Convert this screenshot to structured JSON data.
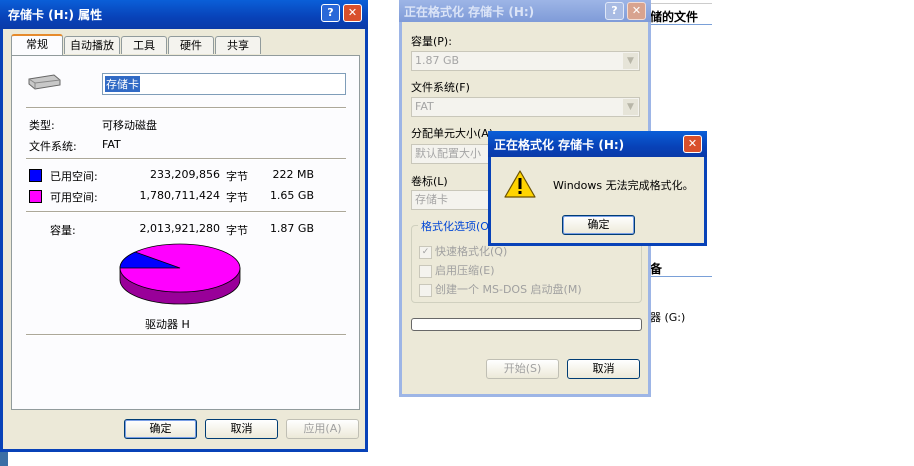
{
  "props": {
    "title": "存储卡 (H:) 属性",
    "tabs": [
      "常规",
      "自动播放",
      "工具",
      "硬件",
      "共享"
    ],
    "name_value": "存储卡",
    "type_label": "类型:",
    "type_value": "可移动磁盘",
    "fs_label": "文件系统:",
    "fs_value": "FAT",
    "used_label": "已用空间:",
    "used_bytes": "233,209,856",
    "used_size": "222 MB",
    "free_label": "可用空间:",
    "free_bytes": "1,780,711,424",
    "free_size": "1.65 GB",
    "cap_label": "容量:",
    "cap_bytes": "2,013,921,280",
    "cap_size": "1.87 GB",
    "bytes_unit": "字节",
    "drive_label": "驱动器 H",
    "ok": "确定",
    "cancel": "取消",
    "apply": "应用(A)",
    "used_color": "#0000ff",
    "free_color": "#ff00ff",
    "used_fraction": 0.116
  },
  "format": {
    "title": "正在格式化 存储卡 (H:)",
    "capacity_label": "容量(P):",
    "capacity_value": "1.87 GB",
    "fs_label": "文件系统(F)",
    "fs_value": "FAT",
    "alloc_label": "分配单元大小(A)",
    "alloc_value": "默认配置大小",
    "vol_label": "卷标(L)",
    "vol_value": "存储卡",
    "options_label": "格式化选项(O)",
    "quick": "快速格式化(Q)",
    "compress": "启用压缩(E)",
    "msdos": "创建一个 MS-DOS 启动盘(M)",
    "start": "开始(S)",
    "cancel": "取消"
  },
  "alert": {
    "title": "正在格式化 存储卡 (H:)",
    "message": "Windows 无法完成格式化。",
    "ok": "确定"
  },
  "background": {
    "text1": "储的文件",
    "text2": "备",
    "text3": "器 (G:)"
  }
}
